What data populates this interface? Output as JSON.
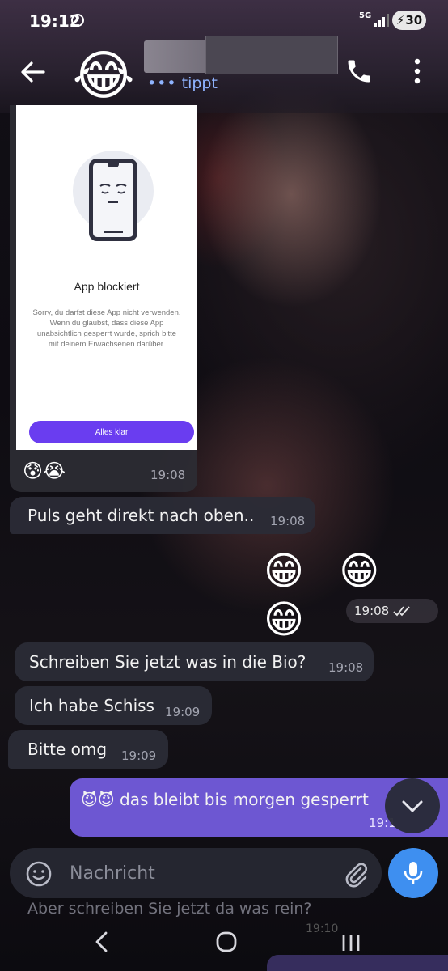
{
  "status_bar": {
    "time": "19:12",
    "network": "5G",
    "battery": "30"
  },
  "header": {
    "avatar_emoji": "😂",
    "status": "tippt",
    "typing_dots": "•••"
  },
  "image_message": {
    "blocked_title": "App blockiert",
    "blocked_body": "Sorry, du darfst diese App nicht verwenden. Wenn du glaubst, dass diese App unabsichtlich gesperrt wurde, sprich bitte mit deinem Erwachsenen darüber.",
    "blocked_button": "Alles klar",
    "caption_emoji": "😰😭",
    "time": "19:08"
  },
  "messages": [
    {
      "text": "Puls geht direkt nach oben..",
      "time": "19:08",
      "direction": "in"
    },
    {
      "text": "😁 😁 😁",
      "time": "19:08",
      "direction": "out"
    },
    {
      "text": "Schreiben Sie jetzt was in die Bio?",
      "time": "19:08",
      "direction": "in"
    },
    {
      "text": "Ich habe Schiss",
      "time": "19:09",
      "direction": "in"
    },
    {
      "text": "Bitte omg",
      "time": "19:09",
      "direction": "in"
    },
    {
      "text": "😈😈 das bleibt bis morgen gesperrt",
      "time": "19:1",
      "direction": "out"
    }
  ],
  "composer": {
    "placeholder": "Nachricht",
    "ghost_text": "Aber schreiben Sie jetzt da was rein?",
    "ghost_time": "19:10"
  },
  "colors": {
    "outgoing_bubble": "#735cdc",
    "incoming_bubble": "#2a2c36",
    "accent": "#3e8ff0",
    "typing": "#8fb4ff"
  },
  "icons": {
    "back": "arrow-left-icon",
    "call": "phone-icon",
    "menu": "more-vertical-icon",
    "emoji": "smile-icon",
    "attach": "paperclip-icon",
    "mic": "microphone-icon",
    "scroll": "chevron-down-icon"
  }
}
